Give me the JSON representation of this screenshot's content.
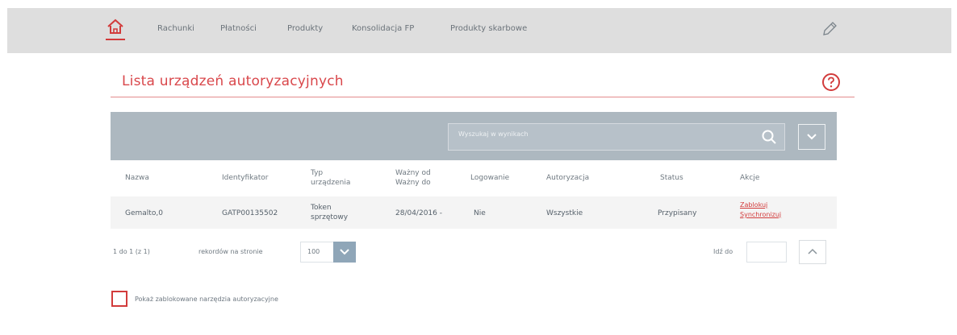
{
  "topnav": {
    "items": [
      "Rachunki",
      "Płatności",
      "Produkty",
      "Konsolidacja FP",
      "Produkty skarbowe"
    ]
  },
  "page": {
    "title": "Lista urządzeń autoryzacyjnych"
  },
  "search": {
    "placeholder": "Wyszukaj w wynikach"
  },
  "table": {
    "headers": {
      "name": "Nazwa",
      "identifier": "Identyfikator",
      "type_line1": "Typ",
      "type_line2": "urządzenia",
      "valid_line1": "Ważny od",
      "valid_line2": "Ważny do",
      "login": "Logowanie",
      "auth": "Autoryzacja",
      "status": "Status",
      "actions": "Akcje"
    },
    "rows": [
      {
        "name": "Gemalto,0",
        "identifier": "GATP00135502",
        "type_line1": "Token",
        "type_line2": "sprzętowy",
        "valid": "28/04/2016 -",
        "login": "Nie",
        "auth": "Wszystkie",
        "status": "Przypisany",
        "action1": "Zablokuj",
        "action2": "Synchronizuj"
      }
    ]
  },
  "pagination": {
    "range": "1 do 1 (z 1)",
    "per_page_label": "rekordów na stronie",
    "per_page_value": "100",
    "goto_label": "Idź do"
  },
  "filter": {
    "show_blocked_label": "Pokaż zablokowane narzędzia autoryzacyjne"
  },
  "colors": {
    "accent": "#d23b3b",
    "topbar": "#dedede",
    "table_header": "#adb8c0"
  }
}
